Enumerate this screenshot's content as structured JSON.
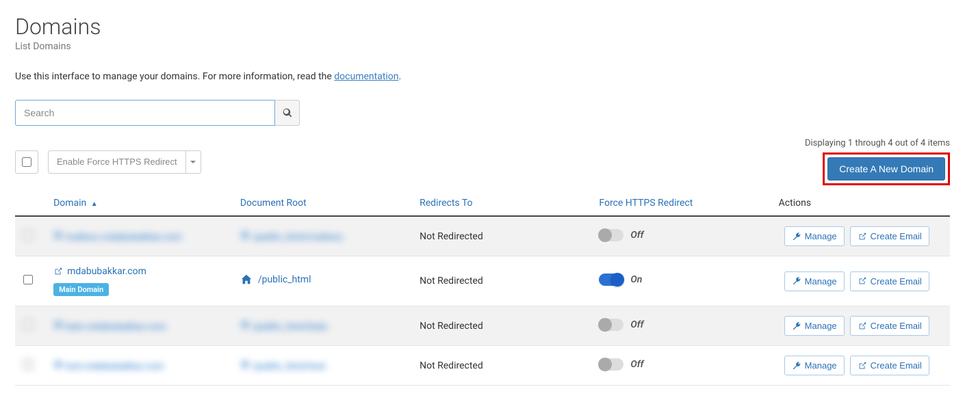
{
  "header": {
    "title": "Domains",
    "subtitle": "List Domains"
  },
  "intro": {
    "prefix": "Use this interface to manage your domains. For more information, read the ",
    "link_label": "documentation",
    "suffix": "."
  },
  "search": {
    "placeholder": "Search"
  },
  "bulk_action": {
    "label": "Enable Force HTTPS Redirect"
  },
  "listing_summary": "Displaying 1 through 4 out of 4 items",
  "create_button": "Create A New Domain",
  "columns": {
    "domain": "Domain",
    "root": "Document Root",
    "redirects": "Redirects To",
    "https": "Force HTTPS Redirect",
    "actions": "Actions"
  },
  "toggle_labels": {
    "on": "On",
    "off": "Off"
  },
  "action_labels": {
    "manage": "Manage",
    "create_email": "Create Email"
  },
  "main_domain_badge": "Main Domain",
  "rows": [
    {
      "domain": "maltesc.mdabubakkar.com",
      "root": "/public_html/maltesc",
      "redirects": "Not Redirected",
      "https_on": false,
      "blurred": true,
      "main": false
    },
    {
      "domain": "mdabubakkar.com",
      "root": "/public_html",
      "redirects": "Not Redirected",
      "https_on": true,
      "blurred": false,
      "main": true
    },
    {
      "domain": "balo.mdabubakkar.com",
      "root": "/public_html/balo",
      "redirects": "Not Redirected",
      "https_on": false,
      "blurred": true,
      "main": false
    },
    {
      "domain": "test.mdabubakkar.com",
      "root": "/public_html/test",
      "redirects": "Not Redirected",
      "https_on": false,
      "blurred": true,
      "main": false
    }
  ]
}
